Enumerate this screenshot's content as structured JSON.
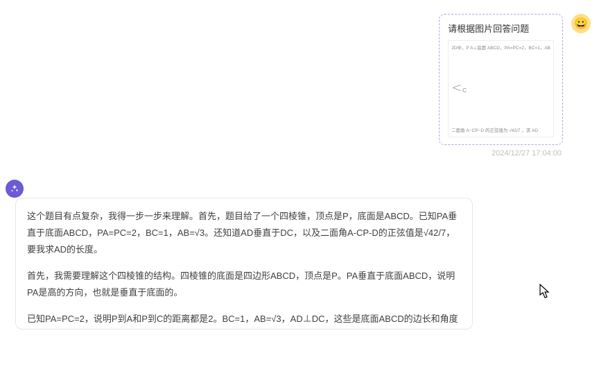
{
  "user": {
    "avatar_emoji": "😀",
    "prompt_title": "请根据图片回答问题",
    "problem_image": {
      "top_text": "2D中，P A⊥底面 ABCD，PA=PC=2，BC=1，AB",
      "diagram_label": "C",
      "bottom_text": "二面角 A−CP−D 的正弦值为 √42/7 ，求 AD"
    },
    "timestamp": "2024/12/27 17:04:00"
  },
  "bot": {
    "paragraphs": [
      "这个题目有点复杂，我得一步一步来理解。首先，题目给了一个四棱锥，顶点是P，底面是ABCD。已知PA垂直于底面ABCD，PA=PC=2，BC=1，AB=√3。还知道AD垂直于DC，以及二面角A-CP-D的正弦值是√42/7，要我求AD的长度。",
      "首先，我需要理解这个四棱锥的结构。四棱锥的底面是四边形ABCD，顶点是P。PA垂直于底面ABCD，说明PA是高的方向，也就是垂直于底面的。",
      "已知PA=PC=2，说明P到A和P到C的距离都是2。BC=1，AB=√3，AD⊥DC，这些是底面ABCD的边长和角度"
    ]
  }
}
